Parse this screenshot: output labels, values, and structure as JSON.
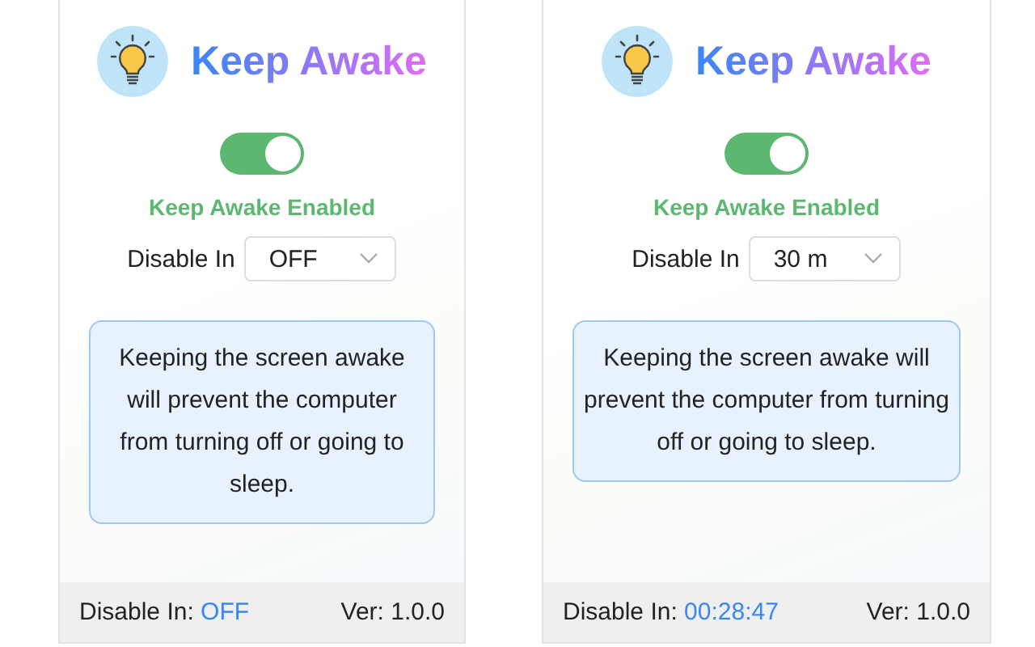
{
  "panels": [
    {
      "title": "Keep Awake",
      "toggle": {
        "on": true
      },
      "status": "Keep Awake Enabled",
      "disable_label": "Disable In",
      "select": {
        "value": "OFF"
      },
      "message": "Keeping the screen awake will prevent the computer from turning off or going to sleep.",
      "footer": {
        "label": "Disable In:",
        "value": "OFF",
        "version": "Ver: 1.0.0"
      }
    },
    {
      "title": "Keep Awake",
      "toggle": {
        "on": true
      },
      "status": "Keep Awake Enabled",
      "disable_label": "Disable In",
      "select": {
        "value": "30 m"
      },
      "message": "Keeping the screen awake will prevent the computer from turning off or going to sleep.",
      "footer": {
        "label": "Disable In:",
        "value": "00:28:47",
        "version": "Ver: 1.0.0"
      }
    }
  ]
}
